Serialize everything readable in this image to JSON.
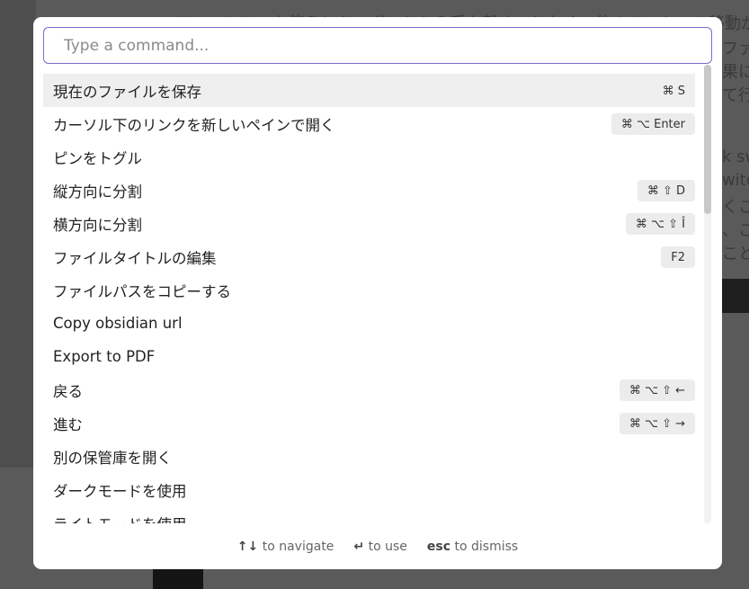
{
  "background": {
    "lines": [
      "Quick switcherを使うとキーボードから手を離すことなく、他のノートへの移動が可",
      "ファイ",
      "果に",
      "て行",
      "k sw",
      "witch",
      "くこ",
      "、こ",
      "ことた"
    ]
  },
  "search": {
    "placeholder": "Type a command..."
  },
  "commands": [
    {
      "label": "現在のファイルを保存",
      "shortcut": "⌘ S"
    },
    {
      "label": "カーソル下のリンクを新しいペインで開く",
      "shortcut": "⌘ ⌥ Enter"
    },
    {
      "label": "ピンをトグル",
      "shortcut": ""
    },
    {
      "label": "縦方向に分割",
      "shortcut": "⌘ ⇧ D"
    },
    {
      "label": "横方向に分割",
      "shortcut": "⌘ ⌥ ⇧ Î"
    },
    {
      "label": "ファイルタイトルの編集",
      "shortcut": "F2"
    },
    {
      "label": "ファイルパスをコピーする",
      "shortcut": ""
    },
    {
      "label": "Copy obsidian url",
      "shortcut": ""
    },
    {
      "label": "Export to PDF",
      "shortcut": ""
    },
    {
      "label": "戻る",
      "shortcut": "⌘ ⌥ ⇧ ←"
    },
    {
      "label": "進む",
      "shortcut": "⌘ ⌥ ⇧ →"
    },
    {
      "label": "別の保管庫を開く",
      "shortcut": ""
    },
    {
      "label": "ダークモードを使用",
      "shortcut": ""
    },
    {
      "label": "ライトモードを使用",
      "shortcut": ""
    }
  ],
  "footer": {
    "navigate_keys": "↑↓",
    "navigate_text": "to navigate",
    "use_key": "↵",
    "use_text": "to use",
    "dismiss_key": "esc",
    "dismiss_text": "to dismiss"
  },
  "colors": {
    "accent": "#7b6cc9",
    "selected_bg": "#efefef"
  }
}
